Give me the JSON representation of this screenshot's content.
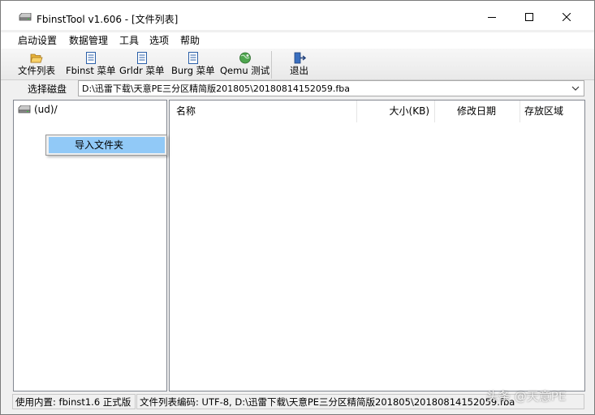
{
  "window": {
    "title": "FbinstTool v1.606 - [文件列表]"
  },
  "menu": [
    "启动设置",
    "数据管理",
    "工具",
    "选项",
    "帮助"
  ],
  "toolbar": {
    "file_list": "文件列表",
    "fbinst_menu": "Fbinst 菜单",
    "grldr_menu": "Grldr 菜单",
    "burg_menu": "Burg 菜单",
    "qemu_test": "Qemu 测试",
    "exit": "退出"
  },
  "disk": {
    "label": "选择磁盘",
    "value": "D:\\迅雷下载\\天意PE三分区精简版201805\\20180814152059.fba"
  },
  "tree": {
    "root_label": "(ud)/"
  },
  "list": {
    "columns": [
      "名称",
      "大小(KB)",
      "修改日期",
      "存放区域"
    ]
  },
  "context_menu": {
    "import_folder": "导入文件夹"
  },
  "status": {
    "core": "使用内置: fbinst1.6 正式版",
    "encoding": "文件列表编码: UTF-8, D:\\迅雷下载\\天意PE三分区精简版201805\\20180814152059.fba"
  },
  "watermark": "头条 @天意PE",
  "icons": {
    "app": "drive-icon",
    "file_list": "folder-open-icon",
    "fbinst_menu": "document-icon",
    "grldr_menu": "document-icon",
    "burg_menu": "document-icon",
    "qemu_test": "globe-icon",
    "exit": "exit-door-icon"
  },
  "colors": {
    "selection": "#91c9f7",
    "chrome": "#f0f0f0",
    "border": "#828790"
  }
}
